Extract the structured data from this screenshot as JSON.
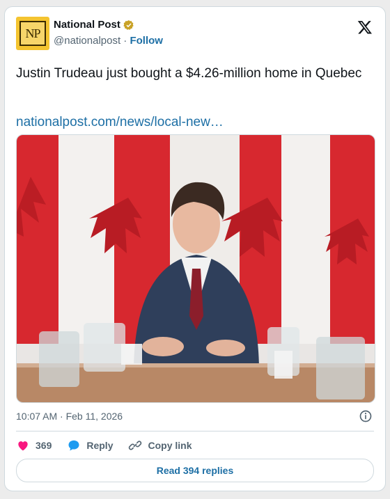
{
  "account": {
    "display_name": "National Post",
    "handle": "@nationalpost",
    "separator": "·",
    "follow_label": "Follow",
    "logo_text": "NP"
  },
  "post": {
    "text": "Justin Trudeau just bought a $4.26-million home in Quebec",
    "link": "nationalpost.com/news/local-new…",
    "timestamp": "10:07 AM · Feb 11, 2026"
  },
  "actions": {
    "like_count": "369",
    "reply_label": "Reply",
    "copy_label": "Copy link",
    "read_replies_label": "Read 394 replies"
  },
  "colors": {
    "link": "#1d6fa5",
    "like": "#f91880",
    "reply": "#1d9bf0",
    "logo_bg": "#f4c430"
  },
  "icons": [
    "verified-badge-icon",
    "x-logo-icon",
    "info-icon",
    "heart-icon",
    "reply-bubble-icon",
    "link-icon"
  ]
}
